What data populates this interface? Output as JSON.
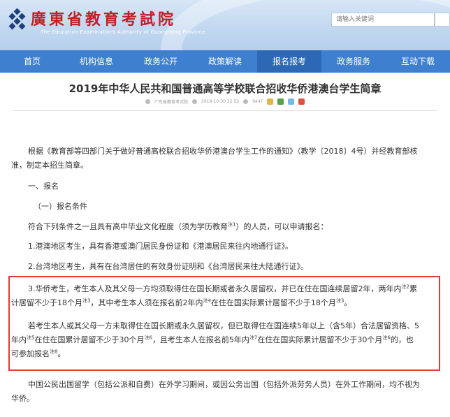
{
  "header": {
    "title": "廣東省教育考試院",
    "subtitle": "The Education Examinations Authority of Guangdong Province",
    "search_placeholder": "请输入关键词"
  },
  "nav": {
    "items": [
      {
        "label": "首页"
      },
      {
        "label": "机构信息"
      },
      {
        "label": "政务公开"
      },
      {
        "label": "政策解读"
      },
      {
        "label": "报名报考"
      },
      {
        "label": "政务服务"
      },
      {
        "label": "互动下载"
      }
    ],
    "active_index": 4
  },
  "article": {
    "title": "2019年中华人民共和国普通高等学校联合招收华侨港澳台学生简章",
    "source": "广东省教育考试院",
    "date": "2018-10-30 22:53",
    "views": "9447",
    "p1a": "根据《教育部等四部门关于做好普通高校联合招收华侨港澳台学生工作的通知》（教学〔2018〕4号）并经教育部核",
    "p1b": "准，制定本招生简章。",
    "h1": "一、报名",
    "h2": "（一）报名条件",
    "p2_pre": "符合下列条件之一且具有高中毕业文化程度（须为学历教育",
    "p2_sup": "注1",
    "p2_post": "）的人员，可以申请报名：",
    "p3": "1.港澳地区考生，具有香港或澳门居民身份证和《港澳居民来往内地通行证》。",
    "p4": "2.台湾地区考生，具有在台湾居住的有效身份证明和《台湾居民来往大陆通行证》。",
    "p5_1": "3.华侨考生，考生本人及其父母一方均须取得住在国长期或者永久居留权，并已在住在国连续居留2年，两年内",
    "p5_sup1": "注2",
    "p5_2": "累",
    "p5_3": "计居留不少于18个月",
    "p5_sup2": "注3",
    "p5_4": "，其中考生本人须在报名前2年内",
    "p5_sup3": "注4",
    "p5_5": "在住在国实际累计居留不少于18个月",
    "p5_sup4": "注3",
    "p5_6": "。",
    "p6_1": "若考生本人或其父母一方未取得住在国长期或永久居留权，但已取得住在国连续5年以上（含5年）合法居留资格、5",
    "p6_2": "年内",
    "p6_sup1": "注5",
    "p6_3": "在住在国累计居留不少于30个月",
    "p6_sup2": "注6",
    "p6_4": "，且考生本人在报名前5年内",
    "p6_sup3": "注7",
    "p6_5": "在住在国实际累计居留不少于30个月",
    "p6_sup4": "注6",
    "p6_6": "的，也",
    "p6_7": "可参加报名",
    "p6_sup5": "注8",
    "p6_8": "。",
    "p7a": "中国公民出国留学（包括公派和自费）在外学习期间，或因公务出国（包括外派劳务人员）在外工作期间，均不视为",
    "p7b": "华侨。"
  },
  "colors": {
    "nav_bg": "#3f7fcf",
    "title_red": "#c0202a",
    "highlight_border": "#e53935"
  }
}
